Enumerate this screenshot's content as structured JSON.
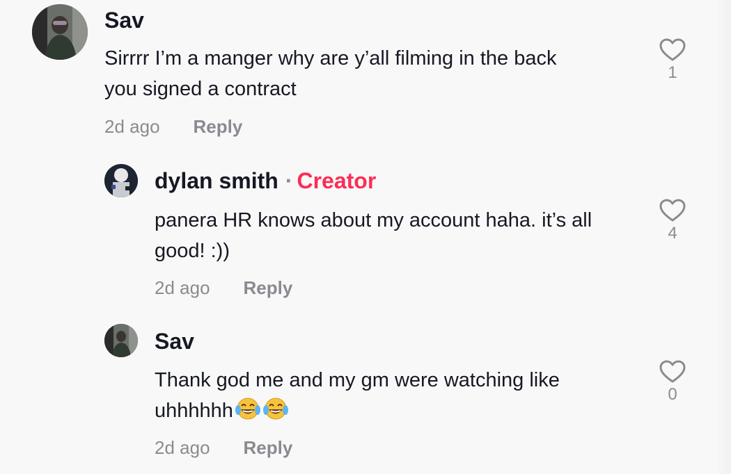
{
  "comments": [
    {
      "username": "Sav",
      "text_line1": "Sirrrr I’m a manger why are y’all filming in the back",
      "text_line2": "you signed a contract",
      "time": "2d ago",
      "reply_label": "Reply",
      "likes": "1",
      "avatar_icon": "user-photo-avatar"
    },
    {
      "username": "dylan smith",
      "separator": "·",
      "badge": "Creator",
      "text_line1": "panera HR knows about my account haha. it’s all",
      "text_line2": "good! :))",
      "time": "2d ago",
      "reply_label": "Reply",
      "likes": "4",
      "avatar_icon": "user-photo-avatar"
    },
    {
      "username": "Sav",
      "text_line1": "Thank god me and my gm were watching like",
      "text_line2": "uhhhhhh",
      "emojis": [
        "face-with-tears-of-joy",
        "face-with-tears-of-joy"
      ],
      "time": "2d ago",
      "reply_label": "Reply",
      "likes": "0",
      "avatar_icon": "user-photo-avatar"
    }
  ],
  "colors": {
    "background": "#f8f8f8",
    "text_primary": "#161823",
    "text_secondary": "#8a8b91",
    "creator_accent": "#fe2c55"
  }
}
